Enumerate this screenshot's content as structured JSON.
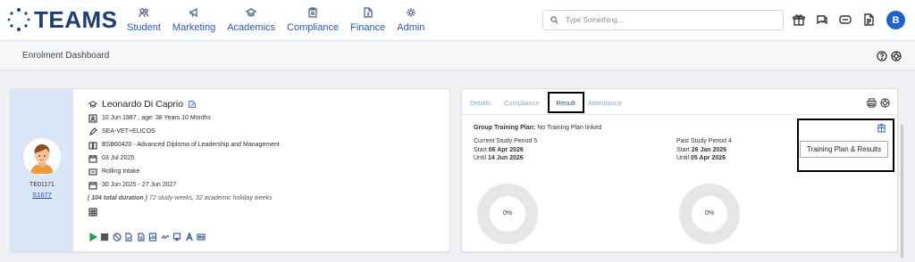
{
  "app": {
    "logo_text": "TEAMS"
  },
  "nav": [
    {
      "label": "Student",
      "icon": "users-icon"
    },
    {
      "label": "Marketing",
      "icon": "megaphone-icon"
    },
    {
      "label": "Academics",
      "icon": "graduation-cap-icon"
    },
    {
      "label": "Compliance",
      "icon": "clipboard-icon"
    },
    {
      "label": "Finance",
      "icon": "document-dollar-icon"
    },
    {
      "label": "Admin",
      "icon": "gear-icon"
    }
  ],
  "search": {
    "placeholder": "Type Something..."
  },
  "user": {
    "avatar_initial": "B"
  },
  "page": {
    "title": "Enrolment Dashboard"
  },
  "student": {
    "id": "TE01171",
    "link": "S1677",
    "name": "Leonardo Di Caprio",
    "dob": "10 Jun 1987 , age: 38 Years 10 Months",
    "program": "SEA-VET+ELICOS",
    "course": "BSB60420 - Advanced Diploma of Leadership and Management",
    "date": "03 Jul 2025",
    "intake": "Rolling Intake",
    "duration_range": "30 Jun 2025 - 27 Jun 2027",
    "duration_total": "( 104 total duration )",
    "duration_detail": "72 study weeks, 32 academic holiday weeks"
  },
  "tabs": [
    {
      "label": "Details",
      "active": false
    },
    {
      "label": "Compliance",
      "active": false
    },
    {
      "label": "Result",
      "active": true
    },
    {
      "label": "Attendance",
      "active": false
    }
  ],
  "result": {
    "group_plan_label": "Group Training Plan:",
    "group_plan_value": "No Training Plan linked",
    "current": {
      "title": "Current Study Period 5",
      "start_label": "Start",
      "start": "06 Apr 2026",
      "until_label": "Until",
      "until": "14 Jun 2026",
      "percent": "0%"
    },
    "past": {
      "title": "Past Study Period 4",
      "start_label": "Start",
      "start": "26 Jan 2026",
      "until_label": "Until",
      "until": "05 Apr 2026",
      "percent": "0%"
    }
  },
  "tooltip": {
    "text": "Training Plan & Results"
  },
  "colors": {
    "accent": "#1f4f99",
    "side_panel": "#d9e6f8",
    "avatar_bg": "#1f63c6",
    "donut": "#e6e6e6"
  }
}
